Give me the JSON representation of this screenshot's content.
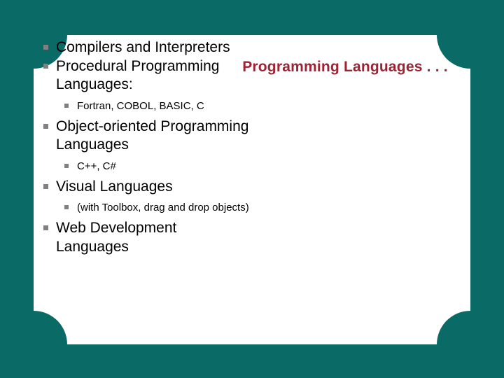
{
  "slide": {
    "title": "Programming Languages . . .",
    "background_color": "#0a6a66",
    "panel_color": "#ffffff",
    "title_color": "#9c2333",
    "bullet_color": "#808080",
    "body_text_color": "#000000"
  },
  "body": {
    "items": [
      {
        "level": 1,
        "text": "Compilers and Interpreters"
      },
      {
        "level": 1,
        "text": "Procedural Programming Languages:"
      },
      {
        "level": 2,
        "text": "Fortran, COBOL, BASIC, C"
      },
      {
        "level": 1,
        "text": "Object-oriented Programming Languages"
      },
      {
        "level": 2,
        "text": "C++, C#"
      },
      {
        "level": 1,
        "text": "Visual Languages"
      },
      {
        "level": 2,
        "text": "(with Toolbox, drag and drop objects)"
      },
      {
        "level": 1,
        "text": "Web Development Languages"
      }
    ]
  }
}
